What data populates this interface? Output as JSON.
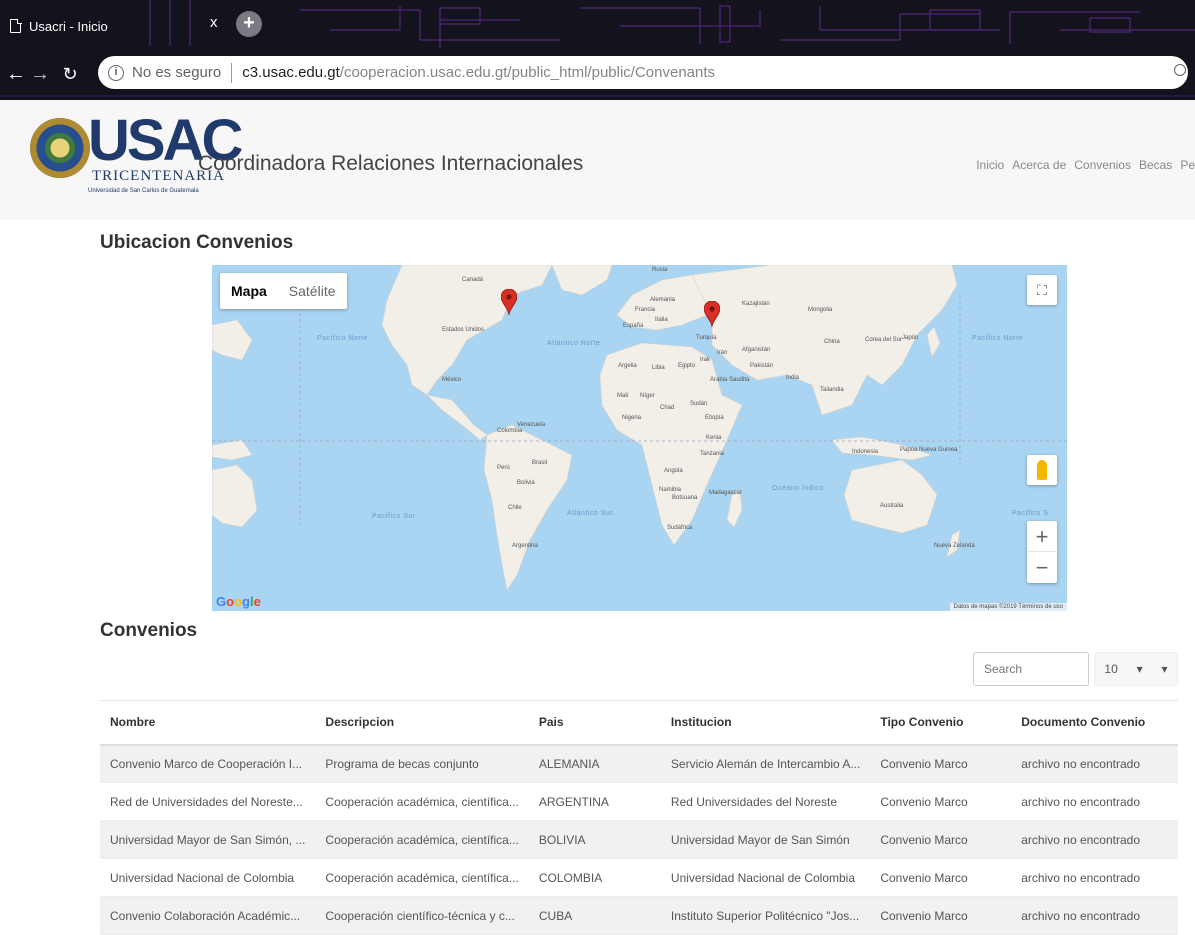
{
  "browser": {
    "tab_title": "Usacri - Inicio",
    "tab_close": "x",
    "new_tab": "+",
    "security_label": "No es seguro",
    "url_host": "c3.usac.edu.gt",
    "url_path": "/cooperacion.usac.edu.gt/public_html/public/Convenants"
  },
  "header": {
    "logo_text": "USAC",
    "logo_sub": "TRICENTENARIA",
    "logo_sub2": "Universidad de San Carlos de Guatemala",
    "site_title": "Coordinadora Relaciones Internacionales",
    "nav": [
      "Inicio",
      "Acerca de",
      "Convenios",
      "Becas",
      "Pe"
    ]
  },
  "map_section": {
    "title": "Ubicacion Convenios",
    "map_type_map": "Mapa",
    "map_type_satellite": "Satélite",
    "zoom_in": "+",
    "zoom_out": "−",
    "google": "Google",
    "credits": "Datos de mapas ©2019   Términos de uso",
    "ocean_labels": [
      "Pacífico Norte",
      "Atlántico Norte",
      "Pacífico Sur",
      "Atlántico Sur",
      "Océano Índico",
      "Pacífico Norte",
      "Pacífico S"
    ],
    "country_labels": [
      "Canadá",
      "Estados Unidos",
      "México",
      "Venezuela",
      "Colombia",
      "Perú",
      "Brasil",
      "Bolivia",
      "Chile",
      "Argentina",
      "Rusia",
      "Alemania",
      "Francia",
      "España",
      "Italia",
      "Turquía",
      "Kazajistán",
      "Mongolia",
      "China",
      "Japón",
      "Corea del Sur",
      "Irán",
      "Irak",
      "Afganistán",
      "Pakistán",
      "India",
      "Argelia",
      "Libia",
      "Egipto",
      "Arabia Saudita",
      "Malí",
      "Níger",
      "Chad",
      "Sudán",
      "Nigeria",
      "Etiopía",
      "Kenia",
      "Tanzania",
      "Angola",
      "Namibia",
      "Botsuana",
      "Madagascar",
      "Sudáfrica",
      "Indonesia",
      "Tailandia",
      "Australia",
      "Nueva Zelanda",
      "Papúa Nueva Guinea"
    ],
    "markers": [
      "Estados Unidos",
      "Turquía"
    ]
  },
  "convenios": {
    "title": "Convenios",
    "search_placeholder": "Search",
    "page_size": "10",
    "columns": [
      "Nombre",
      "Descripcion",
      "Pais",
      "Institucion",
      "Tipo Convenio",
      "Documento Convenio"
    ],
    "rows": [
      [
        "Convenio Marco de Cooperación I...",
        "Programa de becas conjunto",
        "ALEMANIA",
        "Servicio Alemán de Intercambio A...",
        "Convenio Marco",
        "archivo no encontrado"
      ],
      [
        "Red de Universidades del Noreste...",
        "Cooperación académica, científica...",
        "ARGENTINA",
        "Red Universidades del Noreste",
        "Convenio Marco",
        "archivo no encontrado"
      ],
      [
        "Universidad Mayor de San Simón, ...",
        "Cooperación académica, científica...",
        "BOLIVIA",
        "Universidad Mayor de San Simón",
        "Convenio Marco",
        "archivo no encontrado"
      ],
      [
        "Universidad Nacional de Colombia",
        "Cooperación académica, científica...",
        "COLOMBIA",
        "Universidad Nacional de Colombia",
        "Convenio Marco",
        "archivo no encontrado"
      ],
      [
        "Convenio Colaboración Académic...",
        "Cooperación científico-técnica y c...",
        "CUBA",
        "Instituto Superior Politécnico \"Jos...",
        "Convenio Marco",
        "archivo no encontrado"
      ]
    ]
  },
  "colors": {
    "ocean": "#a9d4f2",
    "land": "#f2efe9",
    "marker": "#d93025",
    "logo": "#1f3a6b"
  }
}
